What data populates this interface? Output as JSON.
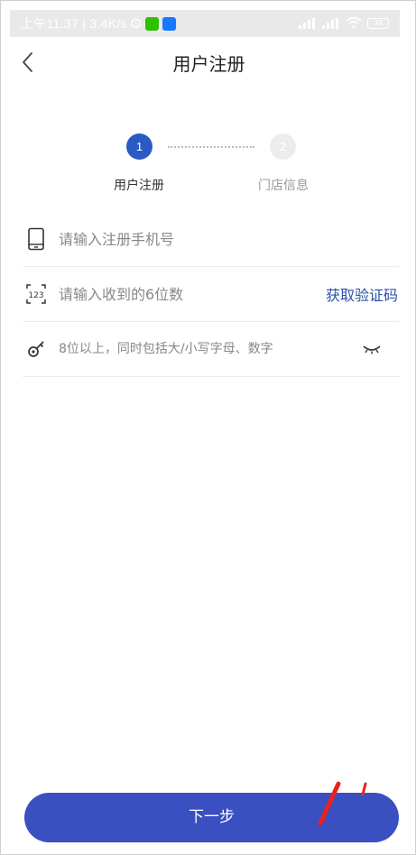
{
  "status_bar": {
    "time_text": "上午11:37 | 3.4K/s",
    "battery": "38",
    "signal": "HD"
  },
  "header": {
    "title": "用户注册"
  },
  "stepper": {
    "steps": [
      {
        "number": "1",
        "label": "用户注册",
        "active": true
      },
      {
        "number": "2",
        "label": "门店信息",
        "active": false
      }
    ]
  },
  "form": {
    "phone_placeholder": "请输入注册手机号",
    "code_placeholder": "请输入收到的6位数",
    "get_code_label": "获取验证码",
    "password_placeholder": "8位以上，同时包括大/小写字母、数字"
  },
  "footer": {
    "next_label": "下一步"
  },
  "colors": {
    "accent": "#2a5bc4",
    "button": "#3a4fc0",
    "link": "#2a4fa8",
    "annotation": "#e8231f"
  }
}
